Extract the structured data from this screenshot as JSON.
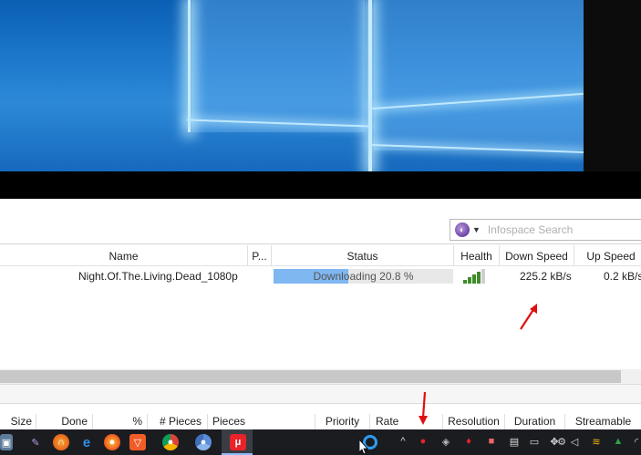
{
  "search": {
    "placeholder": "Infospace Search"
  },
  "torrents": {
    "columns": [
      "Name",
      "P...",
      "Status",
      "Health",
      "Down Speed",
      "Up Speed"
    ],
    "rows": [
      {
        "name": "Night.Of.The.Living.Dead_1080p",
        "status": "Downloading 20.8 %",
        "progress_percent": 20.8,
        "health_bars": 4,
        "down_speed": "225.2 kB/s",
        "up_speed": "0.2 kB/s"
      }
    ]
  },
  "files": {
    "columns": [
      "Size",
      "Done",
      "%",
      "# Pieces",
      "Pieces",
      "Priority",
      "Rate",
      "Resolution",
      "Duration",
      "Streamable"
    ]
  },
  "colors": {
    "progress_fill": "#7fb7f1",
    "health_green": "#3d8c2a",
    "annotation_arrow": "#e01010",
    "taskbar": "#1a1c20"
  },
  "taskbar": {
    "icons": [
      "photos-icon",
      "pen-icon",
      "firefox-icon",
      "edge-icon",
      "firefox-alt-icon",
      "brave-icon",
      "chrome-icon",
      "chromium-icon",
      "bittorrent-icon"
    ],
    "tray": [
      "chevron-up-icon",
      "bittorrent-tray-icon",
      "shield-icon",
      "antivirus-icon",
      "mail-icon",
      "pdf-icon",
      "screen-icon",
      "dropbox-icon",
      "gear-icon",
      "network-icon",
      "volume-icon",
      "flag-icon",
      "google-drive-icon",
      "wifi-icon"
    ]
  }
}
